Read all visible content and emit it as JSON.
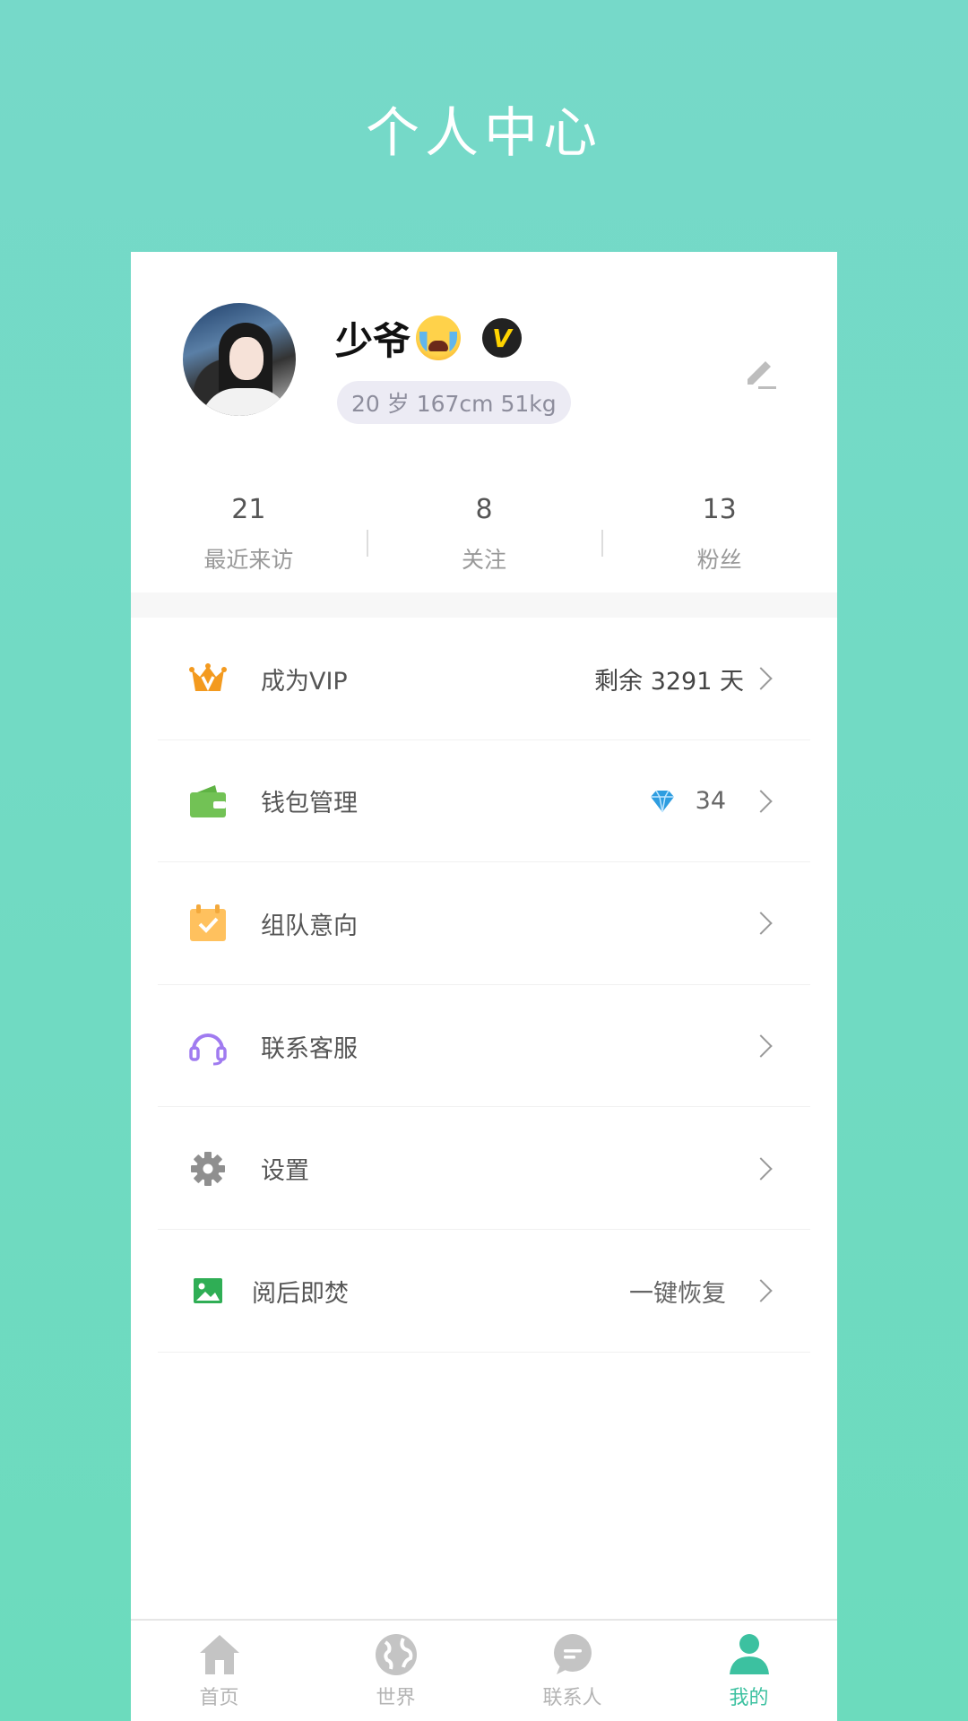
{
  "header": {
    "title": "个人中心"
  },
  "profile": {
    "nickname": "少爷",
    "emoji_icon": "crying-face-icon",
    "badge_text": "V",
    "info": "20 岁 167cm 51kg"
  },
  "stats": [
    {
      "value": "21",
      "label": "最近来访"
    },
    {
      "value": "8",
      "label": "关注"
    },
    {
      "value": "13",
      "label": "粉丝"
    }
  ],
  "menu": [
    {
      "label": "成为VIP",
      "value": "剩余 3291 天",
      "icon": "crown-icon"
    },
    {
      "label": "钱包管理",
      "value": "34",
      "icon": "wallet-icon"
    },
    {
      "label": "组队意向",
      "value": "",
      "icon": "calendar-check-icon"
    },
    {
      "label": "联系客服",
      "value": "",
      "icon": "headset-icon"
    },
    {
      "label": "设置",
      "value": "",
      "icon": "gear-icon"
    },
    {
      "label": "阅后即焚",
      "value": "一键恢复",
      "icon": "image-icon"
    }
  ],
  "tabs": [
    {
      "label": "首页",
      "icon": "home-icon"
    },
    {
      "label": "世界",
      "icon": "globe-icon"
    },
    {
      "label": "联系人",
      "icon": "chat-icon"
    },
    {
      "label": "我的",
      "icon": "user-icon"
    }
  ],
  "colors": {
    "accent": "#3cc1a0",
    "background": "#76d9c9"
  }
}
